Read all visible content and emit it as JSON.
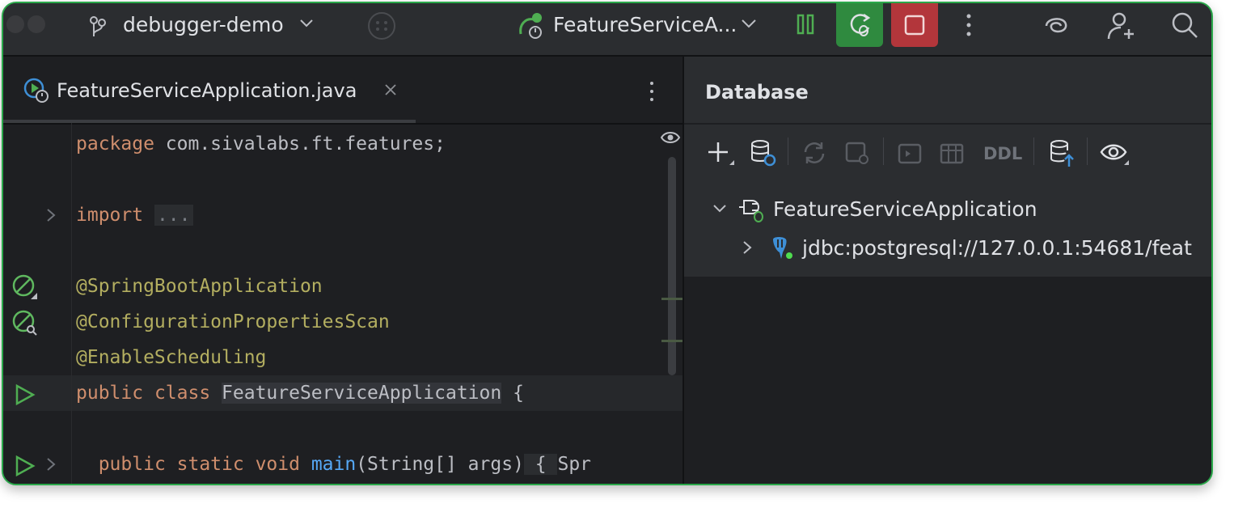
{
  "titlebar": {
    "project_name": "debugger-demo",
    "run_config": "FeatureServiceA...",
    "icons": [
      "branch-icon",
      "chevron-down-icon",
      "more-icon",
      "run-config-icon",
      "pause-icon",
      "rerun-debug-icon",
      "stop-icon",
      "kebab-icon",
      "ai-assistant-icon",
      "add-user-icon",
      "search-icon"
    ],
    "colors": {
      "accent_green": "#2f8a3f",
      "stop_red": "#b3363b",
      "pause_green": "#4fae52"
    }
  },
  "editor": {
    "tab_title": "FeatureServiceApplication.java",
    "lines": {
      "pkg_kw": "package",
      "pkg_name": " com.sivalabs.ft.features;",
      "import_kw": "import",
      "import_fold": "...",
      "ann1": "@SpringBootApplication",
      "ann2": "@ConfigurationPropertiesScan",
      "ann3": "@EnableScheduling",
      "class_public": "public",
      "class_class": " class ",
      "class_name": "FeatureServiceApplication",
      "class_brace": " {",
      "main_kw": "public static void",
      "main_space": " ",
      "main_fn": "main",
      "main_args": "(String[] args)",
      "main_brace": " { ",
      "main_rest": "Spr"
    }
  },
  "database": {
    "header": "Database",
    "toolbar": {
      "ddl_label": "DDL"
    },
    "tree": {
      "root": "FeatureServiceApplication",
      "child": "jdbc:postgresql://127.0.0.1:54681/feat"
    }
  }
}
